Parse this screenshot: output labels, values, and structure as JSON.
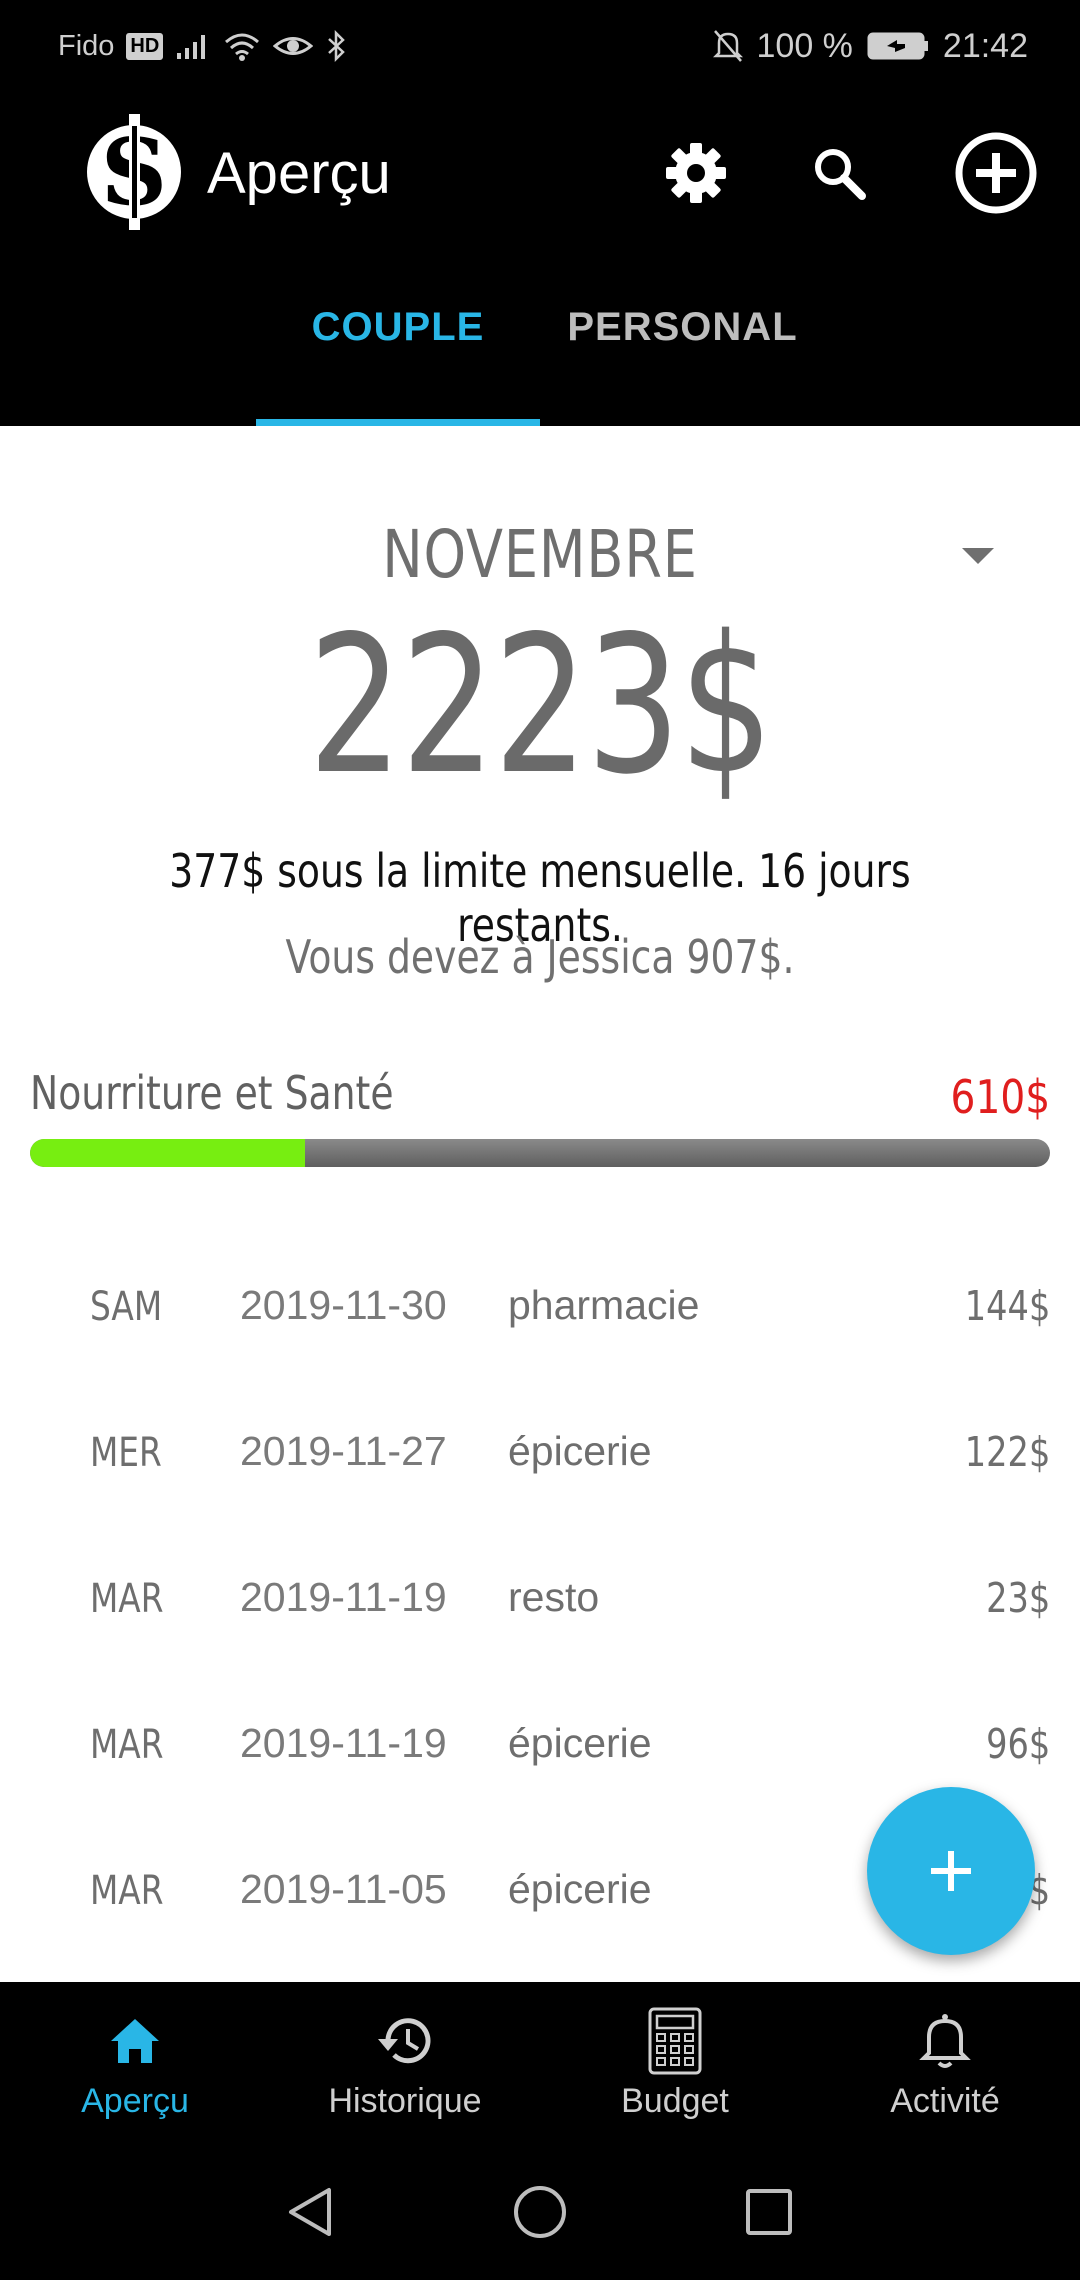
{
  "status_bar": {
    "carrier": "Fido",
    "hd_badge": "HD",
    "battery": "100 %",
    "time": "21:42"
  },
  "app_bar": {
    "title": "Aperçu",
    "icons": [
      "dollar-logo-icon",
      "gear-icon",
      "search-icon",
      "add-circle-icon"
    ]
  },
  "tabs": [
    {
      "label": "COUPLE",
      "active": true
    },
    {
      "label": "PERSONAL",
      "active": false
    }
  ],
  "summary": {
    "month": "NOVEMBRE",
    "total": "2223$",
    "limit_text": "377$ sous la limite mensuelle. 16 jours restants.",
    "owe_text": "Vous devez à Jessica 907$."
  },
  "category": {
    "name": "Nourriture et Santé",
    "amount": "610$",
    "progress": 0.27
  },
  "transactions": [
    {
      "day": "SAM",
      "date": "2019-11-30",
      "description": "pharmacie",
      "amount": "144$"
    },
    {
      "day": "MER",
      "date": "2019-11-27",
      "description": "épicerie",
      "amount": "122$"
    },
    {
      "day": "MAR",
      "date": "2019-11-19",
      "description": "resto",
      "amount": "23$"
    },
    {
      "day": "MAR",
      "date": "2019-11-19",
      "description": "épicerie",
      "amount": "96$"
    },
    {
      "day": "MAR",
      "date": "2019-11-05",
      "description": "épicerie",
      "amount": "$"
    }
  ],
  "bottom_nav": [
    {
      "label": "Aperçu",
      "icon": "home-icon",
      "active": true
    },
    {
      "label": "Historique",
      "icon": "history-icon",
      "active": false
    },
    {
      "label": "Budget",
      "icon": "calculator-icon",
      "active": false
    },
    {
      "label": "Activité",
      "icon": "bell-icon",
      "active": false
    }
  ],
  "colors": {
    "accent": "#29b6e6",
    "progress_fill": "#77ee11",
    "over_amount": "#e01e1e"
  }
}
